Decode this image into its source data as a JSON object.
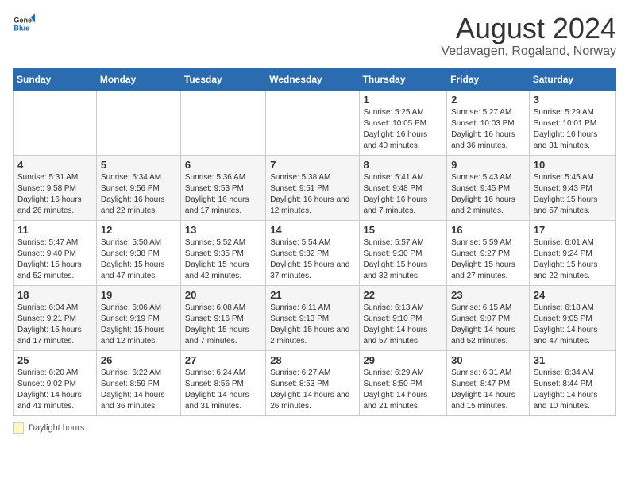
{
  "logo": {
    "general": "General",
    "blue": "Blue"
  },
  "title": "August 2024",
  "subtitle": "Vedavagen, Rogaland, Norway",
  "days_of_week": [
    "Sunday",
    "Monday",
    "Tuesday",
    "Wednesday",
    "Thursday",
    "Friday",
    "Saturday"
  ],
  "footer_label": "Daylight hours",
  "weeks": [
    [
      {
        "day": "",
        "sunrise": "",
        "sunset": "",
        "daylight": ""
      },
      {
        "day": "",
        "sunrise": "",
        "sunset": "",
        "daylight": ""
      },
      {
        "day": "",
        "sunrise": "",
        "sunset": "",
        "daylight": ""
      },
      {
        "day": "",
        "sunrise": "",
        "sunset": "",
        "daylight": ""
      },
      {
        "day": "1",
        "sunrise": "Sunrise: 5:25 AM",
        "sunset": "Sunset: 10:05 PM",
        "daylight": "Daylight: 16 hours and 40 minutes."
      },
      {
        "day": "2",
        "sunrise": "Sunrise: 5:27 AM",
        "sunset": "Sunset: 10:03 PM",
        "daylight": "Daylight: 16 hours and 36 minutes."
      },
      {
        "day": "3",
        "sunrise": "Sunrise: 5:29 AM",
        "sunset": "Sunset: 10:01 PM",
        "daylight": "Daylight: 16 hours and 31 minutes."
      }
    ],
    [
      {
        "day": "4",
        "sunrise": "Sunrise: 5:31 AM",
        "sunset": "Sunset: 9:58 PM",
        "daylight": "Daylight: 16 hours and 26 minutes."
      },
      {
        "day": "5",
        "sunrise": "Sunrise: 5:34 AM",
        "sunset": "Sunset: 9:56 PM",
        "daylight": "Daylight: 16 hours and 22 minutes."
      },
      {
        "day": "6",
        "sunrise": "Sunrise: 5:36 AM",
        "sunset": "Sunset: 9:53 PM",
        "daylight": "Daylight: 16 hours and 17 minutes."
      },
      {
        "day": "7",
        "sunrise": "Sunrise: 5:38 AM",
        "sunset": "Sunset: 9:51 PM",
        "daylight": "Daylight: 16 hours and 12 minutes."
      },
      {
        "day": "8",
        "sunrise": "Sunrise: 5:41 AM",
        "sunset": "Sunset: 9:48 PM",
        "daylight": "Daylight: 16 hours and 7 minutes."
      },
      {
        "day": "9",
        "sunrise": "Sunrise: 5:43 AM",
        "sunset": "Sunset: 9:45 PM",
        "daylight": "Daylight: 16 hours and 2 minutes."
      },
      {
        "day": "10",
        "sunrise": "Sunrise: 5:45 AM",
        "sunset": "Sunset: 9:43 PM",
        "daylight": "Daylight: 15 hours and 57 minutes."
      }
    ],
    [
      {
        "day": "11",
        "sunrise": "Sunrise: 5:47 AM",
        "sunset": "Sunset: 9:40 PM",
        "daylight": "Daylight: 15 hours and 52 minutes."
      },
      {
        "day": "12",
        "sunrise": "Sunrise: 5:50 AM",
        "sunset": "Sunset: 9:38 PM",
        "daylight": "Daylight: 15 hours and 47 minutes."
      },
      {
        "day": "13",
        "sunrise": "Sunrise: 5:52 AM",
        "sunset": "Sunset: 9:35 PM",
        "daylight": "Daylight: 15 hours and 42 minutes."
      },
      {
        "day": "14",
        "sunrise": "Sunrise: 5:54 AM",
        "sunset": "Sunset: 9:32 PM",
        "daylight": "Daylight: 15 hours and 37 minutes."
      },
      {
        "day": "15",
        "sunrise": "Sunrise: 5:57 AM",
        "sunset": "Sunset: 9:30 PM",
        "daylight": "Daylight: 15 hours and 32 minutes."
      },
      {
        "day": "16",
        "sunrise": "Sunrise: 5:59 AM",
        "sunset": "Sunset: 9:27 PM",
        "daylight": "Daylight: 15 hours and 27 minutes."
      },
      {
        "day": "17",
        "sunrise": "Sunrise: 6:01 AM",
        "sunset": "Sunset: 9:24 PM",
        "daylight": "Daylight: 15 hours and 22 minutes."
      }
    ],
    [
      {
        "day": "18",
        "sunrise": "Sunrise: 6:04 AM",
        "sunset": "Sunset: 9:21 PM",
        "daylight": "Daylight: 15 hours and 17 minutes."
      },
      {
        "day": "19",
        "sunrise": "Sunrise: 6:06 AM",
        "sunset": "Sunset: 9:19 PM",
        "daylight": "Daylight: 15 hours and 12 minutes."
      },
      {
        "day": "20",
        "sunrise": "Sunrise: 6:08 AM",
        "sunset": "Sunset: 9:16 PM",
        "daylight": "Daylight: 15 hours and 7 minutes."
      },
      {
        "day": "21",
        "sunrise": "Sunrise: 6:11 AM",
        "sunset": "Sunset: 9:13 PM",
        "daylight": "Daylight: 15 hours and 2 minutes."
      },
      {
        "day": "22",
        "sunrise": "Sunrise: 6:13 AM",
        "sunset": "Sunset: 9:10 PM",
        "daylight": "Daylight: 14 hours and 57 minutes."
      },
      {
        "day": "23",
        "sunrise": "Sunrise: 6:15 AM",
        "sunset": "Sunset: 9:07 PM",
        "daylight": "Daylight: 14 hours and 52 minutes."
      },
      {
        "day": "24",
        "sunrise": "Sunrise: 6:18 AM",
        "sunset": "Sunset: 9:05 PM",
        "daylight": "Daylight: 14 hours and 47 minutes."
      }
    ],
    [
      {
        "day": "25",
        "sunrise": "Sunrise: 6:20 AM",
        "sunset": "Sunset: 9:02 PM",
        "daylight": "Daylight: 14 hours and 41 minutes."
      },
      {
        "day": "26",
        "sunrise": "Sunrise: 6:22 AM",
        "sunset": "Sunset: 8:59 PM",
        "daylight": "Daylight: 14 hours and 36 minutes."
      },
      {
        "day": "27",
        "sunrise": "Sunrise: 6:24 AM",
        "sunset": "Sunset: 8:56 PM",
        "daylight": "Daylight: 14 hours and 31 minutes."
      },
      {
        "day": "28",
        "sunrise": "Sunrise: 6:27 AM",
        "sunset": "Sunset: 8:53 PM",
        "daylight": "Daylight: 14 hours and 26 minutes."
      },
      {
        "day": "29",
        "sunrise": "Sunrise: 6:29 AM",
        "sunset": "Sunset: 8:50 PM",
        "daylight": "Daylight: 14 hours and 21 minutes."
      },
      {
        "day": "30",
        "sunrise": "Sunrise: 6:31 AM",
        "sunset": "Sunset: 8:47 PM",
        "daylight": "Daylight: 14 hours and 15 minutes."
      },
      {
        "day": "31",
        "sunrise": "Sunrise: 6:34 AM",
        "sunset": "Sunset: 8:44 PM",
        "daylight": "Daylight: 14 hours and 10 minutes."
      }
    ]
  ]
}
